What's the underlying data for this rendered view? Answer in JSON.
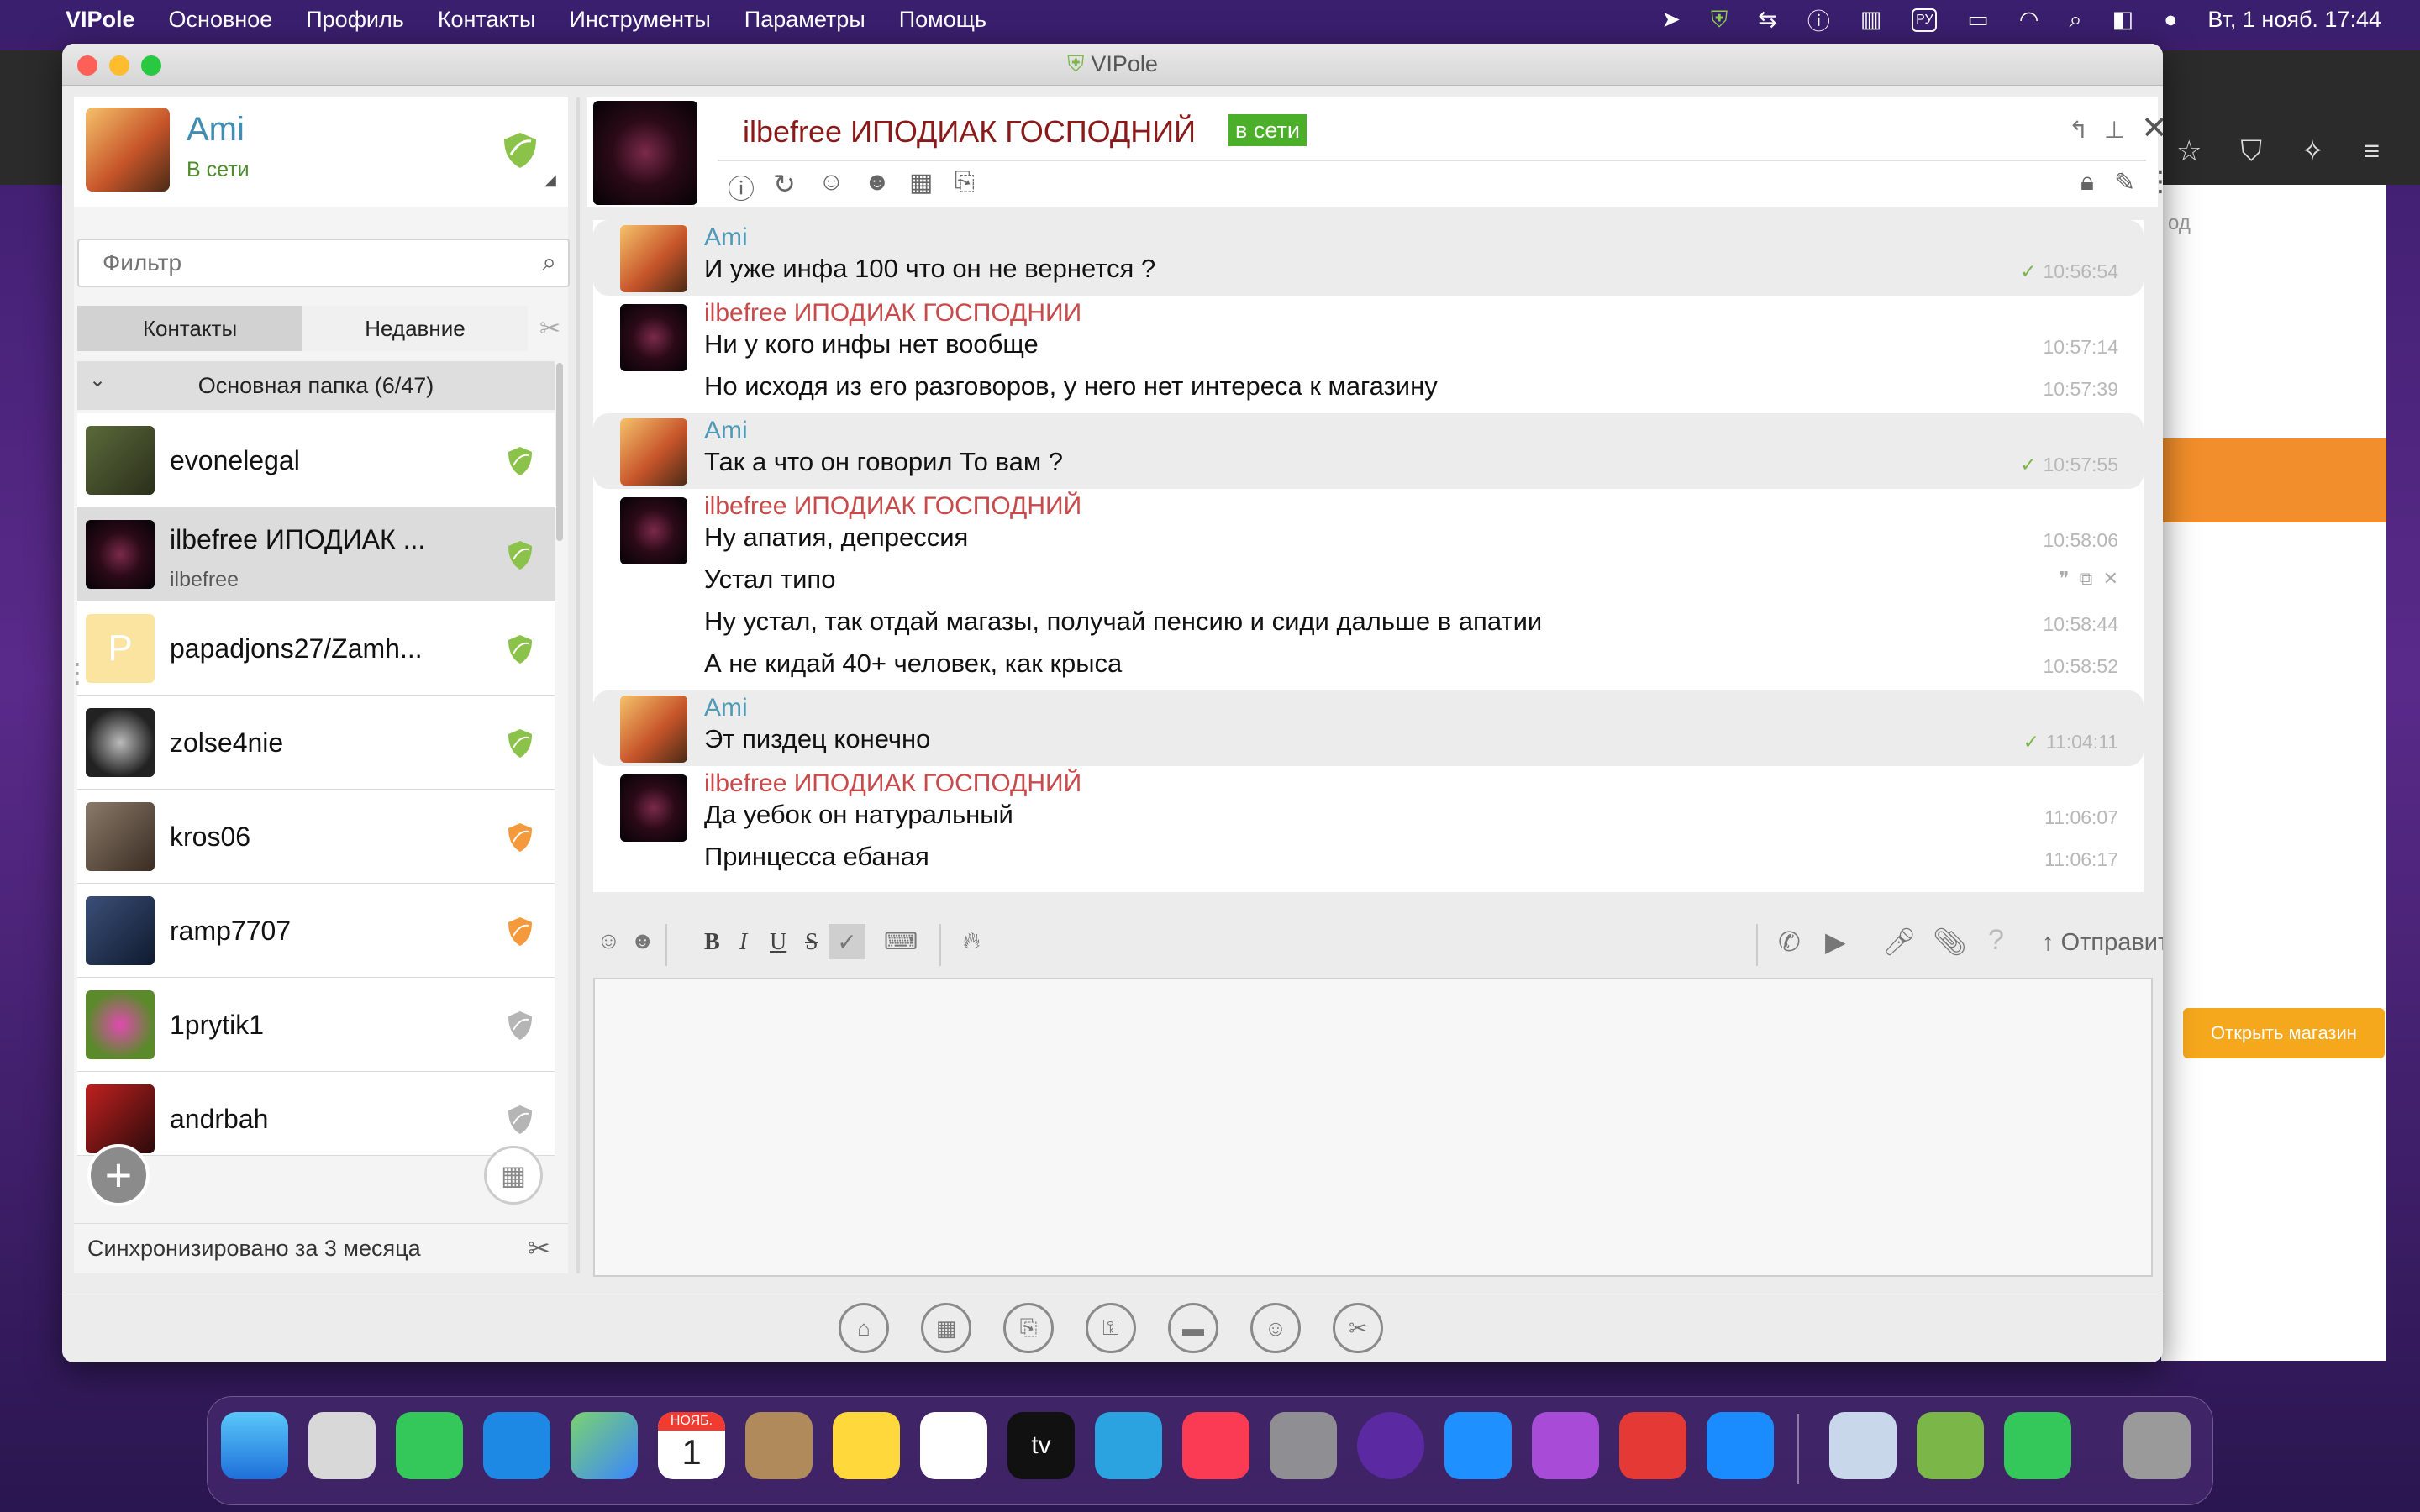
{
  "menubar": {
    "app": "VIPole",
    "items": [
      "Основное",
      "Профиль",
      "Контакты",
      "Инструменты",
      "Параметры",
      "Помощь"
    ],
    "lang": "РУ",
    "datetime": "Вт, 1 нояб. 17:44"
  },
  "window": {
    "title": "VIPole"
  },
  "profile": {
    "name": "Ami",
    "status": "В сети"
  },
  "filter": {
    "placeholder": "Фильтр"
  },
  "tabs": {
    "contacts": "Контакты",
    "recent": "Недавние"
  },
  "folder": {
    "label": "Основная папка (6/47)"
  },
  "contacts": [
    {
      "name": "evonelegal",
      "sub": "",
      "shield": "green"
    },
    {
      "name": "ilbefree  ИПОДИАК ...",
      "sub": "ilbefree",
      "shield": "green"
    },
    {
      "name": "papadjons27/Zamh...",
      "sub": "",
      "shield": "green",
      "letter": "P"
    },
    {
      "name": "zolse4nie",
      "sub": "",
      "shield": "green"
    },
    {
      "name": "kros06",
      "sub": "",
      "shield": "orange"
    },
    {
      "name": "ramp7707",
      "sub": "",
      "shield": "orange"
    },
    {
      "name": "1prytik1",
      "sub": "",
      "shield": "gray"
    },
    {
      "name": "andrbah",
      "sub": "",
      "shield": "gray"
    }
  ],
  "sync": {
    "label": "Синхронизировано за 3 месяца"
  },
  "chat": {
    "contact_name": "ilbefree  ИПОДИАК ГОСПОДНИЙ",
    "online_badge": "в сети",
    "messages": [
      {
        "from": "Ami",
        "mine": true,
        "lines": [
          {
            "text": "И уже инфа 100 что он не вернется ?",
            "time": "10:56:54"
          }
        ]
      },
      {
        "from": "ilbefree  ИПОДИАК ГОСПОДНИИ",
        "mine": false,
        "lines": [
          {
            "text": "Ни у кого инфы нет вообще",
            "time": "10:57:14"
          },
          {
            "text": "Но исходя из его разговоров, у него нет интереса к магазину",
            "time": "10:57:39"
          }
        ]
      },
      {
        "from": "Ami",
        "mine": true,
        "lines": [
          {
            "text": "Так а что он говорил То вам ?",
            "time": "10:57:55"
          }
        ]
      },
      {
        "from": "ilbefree  ИПОДИАК ГОСПОДНИЙ",
        "mine": false,
        "lines": [
          {
            "text": "Ну апатия, депрессия",
            "time": "10:58:06"
          },
          {
            "text": "Устал типо",
            "time": ""
          },
          {
            "text": "Ну устал, так отдай магазы, получай пенсию и сиди дальше в апатии",
            "time": "10:58:44"
          },
          {
            "text": "А не кидай 40+ человек, как крыса",
            "time": "10:58:52"
          }
        ]
      },
      {
        "from": "Ami",
        "mine": true,
        "lines": [
          {
            "text": "Эт пиздец конечно",
            "time": "11:04:11"
          }
        ]
      },
      {
        "from": "ilbefree  ИПОДИАК ГОСПОДНИЙ",
        "mine": false,
        "lines": [
          {
            "text": "Да уебок он натуральный",
            "time": "11:06:07"
          },
          {
            "text": "Принцесса ебаная",
            "time": "11:06:17"
          }
        ]
      }
    ]
  },
  "composer": {
    "send_label": "Отправить",
    "format": {
      "bold": "B",
      "italic": "I",
      "underline": "U",
      "strike": "S"
    }
  },
  "background": {
    "open_shop": "Открыть магазин",
    "partial_text": "од"
  },
  "dock": {
    "calendar_month": "НОЯБ.",
    "calendar_day": "1"
  }
}
